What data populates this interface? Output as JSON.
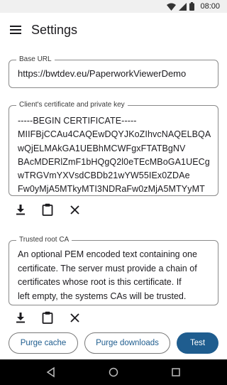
{
  "status_bar": {
    "time": "08:00",
    "icons": [
      "wifi-icon",
      "signal-icon",
      "battery-icon"
    ]
  },
  "app_bar": {
    "title": "Settings",
    "menu_icon": "hamburger-menu-icon"
  },
  "fields": {
    "base_url": {
      "label": "Base URL",
      "value": "https://bwtdev.eu/PaperworkViewerDemo"
    },
    "client_cert": {
      "label": "Client's certificate and private key",
      "lines": [
        "-----BEGIN CERTIFICATE-----",
        "MIIFBjCCAu4CAQEwDQYJKoZIhvcNAQELBQA",
        "wQjELMAkGA1UEBhMCWFgxFTATBgNV",
        "BAcMDERlZmF1bHQgQ2l0eTEcMBoGA1UECg",
        "wTRGVmYXVsdCBDb21wYW55IEx0ZDAe",
        "Fw0yMjA5MTkyMTI3NDRaFw0zMjA5MTYyMT"
      ]
    },
    "trusted_ca": {
      "label": "Trusted root CA",
      "lines": [
        "An optional PEM encoded text containing one",
        "certificate. The server must provide a chain of",
        "certificates whose root is this certificate. If",
        "left empty, the systems CAs will be trusted."
      ]
    }
  },
  "field_actions": [
    "download-icon",
    "paste-clipboard-icon",
    "clear-icon"
  ],
  "buttons": {
    "purge_cache": "Purge cache",
    "purge_downloads": "Purge downloads",
    "test": "Test"
  },
  "colors": {
    "accent": "#1f5d8f",
    "outline": "#8a8a8a",
    "status_bar": "#f0f0f0",
    "nav_bar": "#000000"
  },
  "nav_bar": [
    "back-icon",
    "home-icon",
    "recents-icon"
  ]
}
